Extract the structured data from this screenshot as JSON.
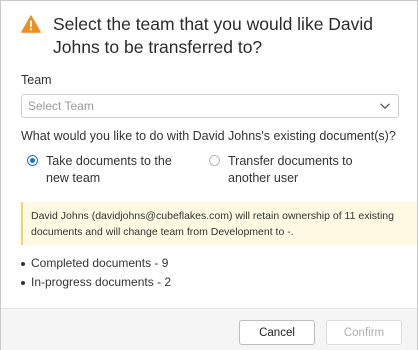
{
  "dialog": {
    "title": "Select the team that you would like David Johns to be transferred to?",
    "title_icon": "warning-icon",
    "accent_color": "#f28c1c"
  },
  "team": {
    "label": "Team",
    "select_placeholder": "Select Team"
  },
  "documents_question": "What would you like to do with David Johns's existing document(s)?",
  "options": [
    {
      "label": "Take documents to the new team",
      "selected": true
    },
    {
      "label": "Transfer documents to another user",
      "selected": false
    }
  ],
  "notice": {
    "text": "David Johns (davidjohns@cubeflakes.com) will retain ownership of 11 existing documents and will change team from Development to -."
  },
  "stats": [
    {
      "text": "Completed documents - 9"
    },
    {
      "text": "In-progress documents - 2"
    }
  ],
  "footer": {
    "cancel_label": "Cancel",
    "confirm_label": "Confirm"
  }
}
